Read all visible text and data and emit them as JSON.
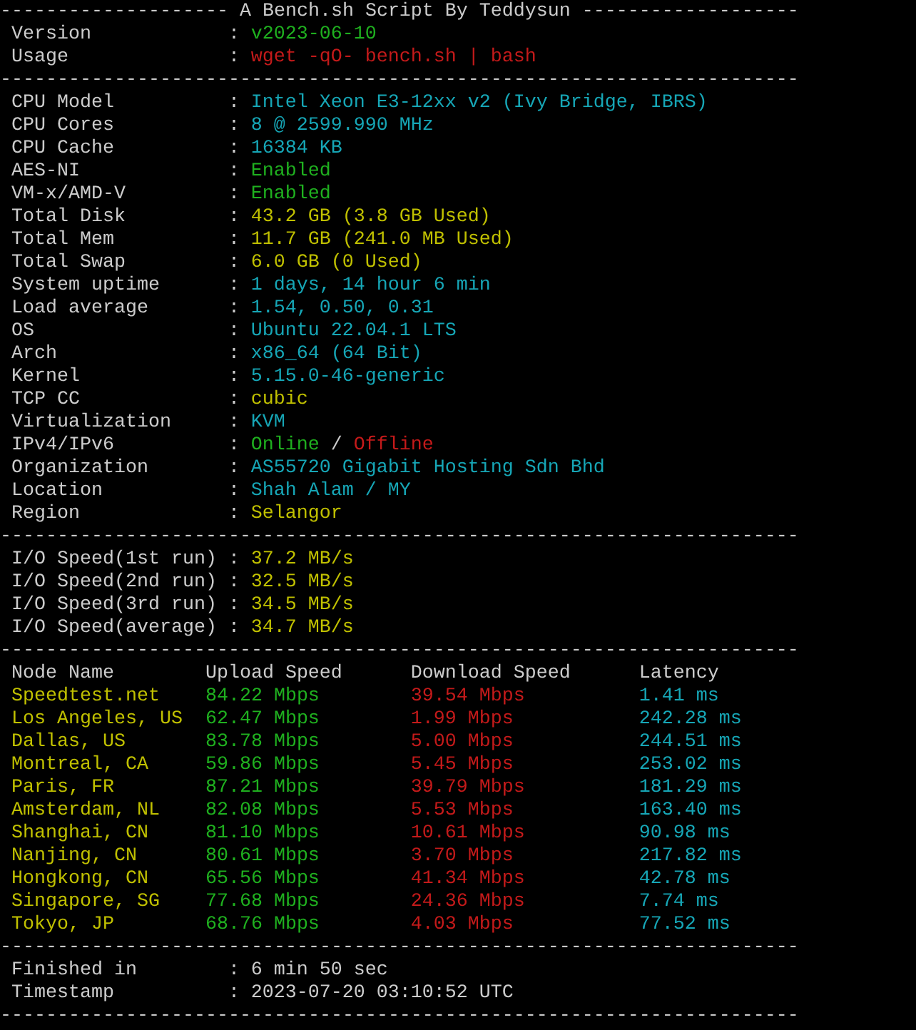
{
  "lines": [
    {
      "kind": "title",
      "text": "-------------------- A Bench.sh Script By Teddysun -------------------"
    },
    {
      "kind": "kv",
      "label": "Version",
      "sep": ":",
      "value": [
        {
          "text": "v2023-06-10",
          "color": "#1fb01f"
        }
      ]
    },
    {
      "kind": "kv",
      "label": "Usage",
      "sep": ":",
      "value": [
        {
          "text": "wget -qO- bench.sh | bash",
          "color": "#c41a1a"
        }
      ]
    },
    {
      "kind": "rule",
      "text": "----------------------------------------------------------------------"
    },
    {
      "kind": "kv",
      "label": "CPU Model",
      "sep": ":",
      "value": [
        {
          "text": "Intel Xeon E3-12xx v2 (Ivy Bridge, IBRS)",
          "color": "#16a6b6"
        }
      ]
    },
    {
      "kind": "kv",
      "label": "CPU Cores",
      "sep": ":",
      "value": [
        {
          "text": "8 @ 2599.990 MHz",
          "color": "#16a6b6"
        }
      ]
    },
    {
      "kind": "kv",
      "label": "CPU Cache",
      "sep": ":",
      "value": [
        {
          "text": "16384 KB",
          "color": "#16a6b6"
        }
      ]
    },
    {
      "kind": "kv",
      "label": "AES-NI",
      "sep": ":",
      "value": [
        {
          "text": "Enabled",
          "color": "#1fb01f"
        }
      ]
    },
    {
      "kind": "kv",
      "label": "VM-x/AMD-V",
      "sep": ":",
      "value": [
        {
          "text": "Enabled",
          "color": "#1fb01f"
        }
      ]
    },
    {
      "kind": "kv",
      "label": "Total Disk",
      "sep": ":",
      "value": [
        {
          "text": "43.2 GB (3.8 GB Used)",
          "color": "#c0c000"
        }
      ]
    },
    {
      "kind": "kv",
      "label": "Total Mem",
      "sep": ":",
      "value": [
        {
          "text": "11.7 GB (241.0 MB Used)",
          "color": "#c0c000"
        }
      ]
    },
    {
      "kind": "kv",
      "label": "Total Swap",
      "sep": ":",
      "value": [
        {
          "text": "6.0 GB (0 Used)",
          "color": "#c0c000"
        }
      ]
    },
    {
      "kind": "kv",
      "label": "System uptime",
      "sep": ":",
      "value": [
        {
          "text": "1 days, 14 hour 6 min",
          "color": "#16a6b6"
        }
      ]
    },
    {
      "kind": "kv",
      "label": "Load average",
      "sep": ":",
      "value": [
        {
          "text": "1.54, 0.50, 0.31",
          "color": "#16a6b6"
        }
      ]
    },
    {
      "kind": "kv",
      "label": "OS",
      "sep": ":",
      "value": [
        {
          "text": "Ubuntu 22.04.1 LTS",
          "color": "#16a6b6"
        }
      ]
    },
    {
      "kind": "kv",
      "label": "Arch",
      "sep": ":",
      "value": [
        {
          "text": "x86_64 (64 Bit)",
          "color": "#16a6b6"
        }
      ]
    },
    {
      "kind": "kv",
      "label": "Kernel",
      "sep": ":",
      "value": [
        {
          "text": "5.15.0-46-generic",
          "color": "#16a6b6"
        }
      ]
    },
    {
      "kind": "kv",
      "label": "TCP CC",
      "sep": ":",
      "value": [
        {
          "text": "cubic",
          "color": "#c0c000"
        }
      ]
    },
    {
      "kind": "kv",
      "label": "Virtualization",
      "sep": ":",
      "value": [
        {
          "text": "KVM",
          "color": "#16a6b6"
        }
      ]
    },
    {
      "kind": "kv",
      "label": "IPv4/IPv6",
      "sep": ":",
      "value": [
        {
          "text": "Online",
          "color": "#1fb01f"
        },
        {
          "text": "/",
          "color": "#cccccc"
        },
        {
          "text": "Offline",
          "color": "#c41a1a"
        }
      ]
    },
    {
      "kind": "kv",
      "label": "Organization",
      "sep": ":",
      "value": [
        {
          "text": "AS55720 Gigabit Hosting Sdn Bhd",
          "color": "#16a6b6"
        }
      ]
    },
    {
      "kind": "kv",
      "label": "Location",
      "sep": ":",
      "value": [
        {
          "text": "Shah Alam / MY",
          "color": "#16a6b6"
        }
      ]
    },
    {
      "kind": "kv",
      "label": "Region",
      "sep": ":",
      "value": [
        {
          "text": "Selangor",
          "color": "#c0c000"
        }
      ]
    },
    {
      "kind": "rule",
      "text": "----------------------------------------------------------------------"
    },
    {
      "kind": "kv",
      "label": "I/O Speed(1st run)",
      "sep": ":",
      "value": [
        {
          "text": "37.2 MB/s",
          "color": "#c0c000"
        }
      ]
    },
    {
      "kind": "kv",
      "label": "I/O Speed(2nd run)",
      "sep": ":",
      "value": [
        {
          "text": "32.5 MB/s",
          "color": "#c0c000"
        }
      ]
    },
    {
      "kind": "kv",
      "label": "I/O Speed(3rd run)",
      "sep": ":",
      "value": [
        {
          "text": "34.5 MB/s",
          "color": "#c0c000"
        }
      ]
    },
    {
      "kind": "kv",
      "label": "I/O Speed(average)",
      "sep": ":",
      "value": [
        {
          "text": "34.7 MB/s",
          "color": "#c0c000"
        }
      ]
    },
    {
      "kind": "rule",
      "text": "----------------------------------------------------------------------"
    },
    {
      "kind": "table",
      "columns": [
        {
          "label": "Node Name",
          "color": "#c0c000"
        },
        {
          "label": "Upload Speed",
          "color": "#1fb01f"
        },
        {
          "label": "Download Speed",
          "color": "#c41a1a"
        },
        {
          "label": "Latency",
          "color": "#16a6b6"
        }
      ],
      "rows": [
        [
          "Speedtest.net",
          "84.22 Mbps",
          "39.54 Mbps",
          "1.41 ms"
        ],
        [
          "Los Angeles, US",
          "62.47 Mbps",
          "1.99 Mbps",
          "242.28 ms"
        ],
        [
          "Dallas, US",
          "83.78 Mbps",
          "5.00 Mbps",
          "244.51 ms"
        ],
        [
          "Montreal, CA",
          "59.86 Mbps",
          "5.45 Mbps",
          "253.02 ms"
        ],
        [
          "Paris, FR",
          "87.21 Mbps",
          "39.79 Mbps",
          "181.29 ms"
        ],
        [
          "Amsterdam, NL",
          "82.08 Mbps",
          "5.53 Mbps",
          "163.40 ms"
        ],
        [
          "Shanghai, CN",
          "81.10 Mbps",
          "10.61 Mbps",
          "90.98 ms"
        ],
        [
          "Nanjing, CN",
          "80.61 Mbps",
          "3.70 Mbps",
          "217.82 ms"
        ],
        [
          "Hongkong, CN",
          "65.56 Mbps",
          "41.34 Mbps",
          "42.78 ms"
        ],
        [
          "Singapore, SG",
          "77.68 Mbps",
          "24.36 Mbps",
          "7.74 ms"
        ],
        [
          "Tokyo, JP",
          "68.76 Mbps",
          "4.03 Mbps",
          "77.52 ms"
        ]
      ]
    },
    {
      "kind": "rule",
      "text": "----------------------------------------------------------------------"
    },
    {
      "kind": "kv",
      "label": "Finished in",
      "sep": ":",
      "value": [
        {
          "text": "6 min 50 sec",
          "color": "#cccccc"
        }
      ]
    },
    {
      "kind": "kv",
      "label": "Timestamp",
      "sep": ":",
      "value": [
        {
          "text": "2023-07-20 03:10:52 UTC",
          "color": "#cccccc"
        }
      ]
    },
    {
      "kind": "rule",
      "text": "----------------------------------------------------------------------"
    }
  ]
}
